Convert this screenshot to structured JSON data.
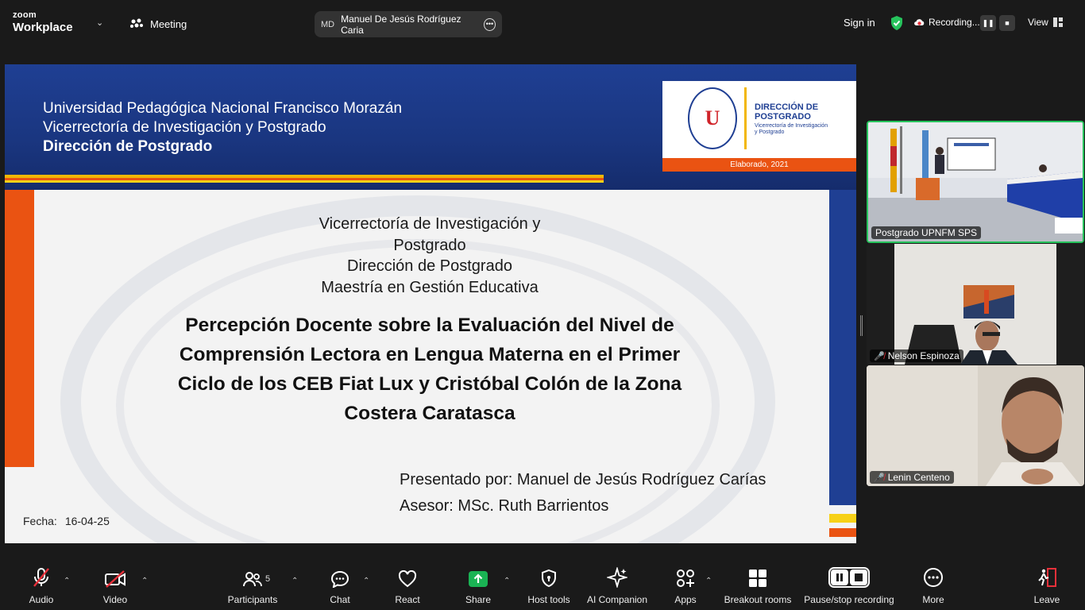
{
  "app": {
    "brand_top": "zoom",
    "brand_bottom": "Workplace"
  },
  "topbar": {
    "meeting_label": "Meeting",
    "active_speaker": {
      "initials": "MD",
      "name": "Manuel De Jesús Rodríguez Caria"
    },
    "sign_in": "Sign in",
    "recording": "Recording...",
    "view": "View"
  },
  "slide": {
    "header_lines": [
      "Universidad Pedagógica Nacional Francisco Morazán",
      "Vicerrectoría de Investigación y Postgrado",
      "Dirección de Postgrado"
    ],
    "logo": {
      "title_line1": "DIRECCIÓN DE",
      "title_line2": "POSTGRADO",
      "sub_line1": "Vicerrectoría de Investigación",
      "sub_line2": "y Postgrado"
    },
    "elaborado": "Elaborado, 2021",
    "sub_lines": [
      "Vicerrectoría de Investigación y",
      "Postgrado",
      "Dirección de Postgrado",
      "Maestría en Gestión Educativa"
    ],
    "title_lines": [
      "Percepción Docente sobre la Evaluación del Nivel de",
      "Comprensión Lectora en Lengua Materna en el Primer",
      "Ciclo de los CEB Fiat Lux y Cristóbal Colón de la Zona",
      "Costera Caratasca"
    ],
    "presented_by": "Presentado por: Manuel de Jesús Rodríguez Carías",
    "advisor": "Asesor: MSc. Ruth Barrientos",
    "date_label": "Fecha:",
    "date_value": "16-04-25"
  },
  "participants_tiles": [
    {
      "name": "Postgrado UPNFM SPS",
      "muted": false,
      "active": true
    },
    {
      "name": "Nelson Espinoza",
      "muted": true,
      "active": false
    },
    {
      "name": "Lenin Centeno",
      "muted": true,
      "active": false
    }
  ],
  "toolbar": {
    "audio": "Audio",
    "video": "Video",
    "participants": "Participants",
    "participants_count": "5",
    "chat": "Chat",
    "react": "React",
    "share": "Share",
    "host_tools": "Host tools",
    "ai_companion": "AI Companion",
    "apps": "Apps",
    "breakout_rooms": "Breakout rooms",
    "pause_stop_recording": "Pause/stop recording",
    "more": "More",
    "leave": "Leave"
  },
  "colors": {
    "accent_green": "#26c35c",
    "share_green": "#1ab354",
    "slide_blue": "#1f3f93",
    "slide_orange": "#ea5312",
    "slide_yellow": "#f7d117",
    "leave_red": "#e8303a"
  }
}
